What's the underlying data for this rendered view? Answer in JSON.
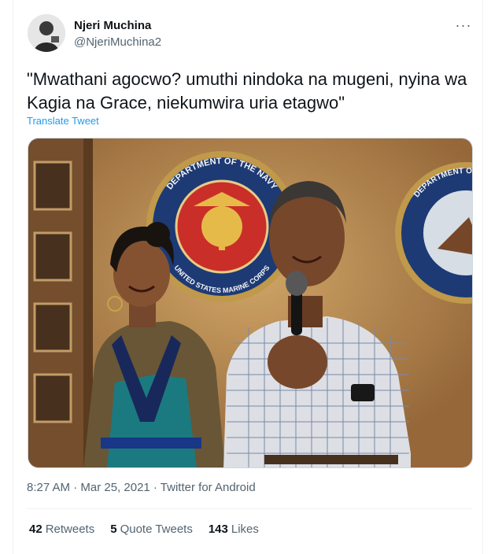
{
  "author": {
    "name": "Njeri Muchina",
    "handle": "@NjeriMuchina2"
  },
  "more_icon": "more-horizontal-icon",
  "tweet": {
    "text": "\"Mwathani agocwo? umuthi nindoka na mugeni, nyina wa Kagia na Grace, niekumwira uria etagwo\"",
    "translate_label": "Translate Tweet"
  },
  "media": {
    "seal_left_top_text": "DEPARTMENT OF THE NAVY",
    "seal_left_bottom_text": "UNITED STATES MARINE CORPS",
    "seal_right_text": "DEPARTMENT OF THE NAVY UNITED STATES"
  },
  "meta": {
    "text": "8:27 AM · Mar 25, 2021 · Twitter for Android"
  },
  "stats": {
    "retweets_count": "42",
    "retweets_label": "Retweets",
    "quotes_count": "5",
    "quotes_label": "Quote Tweets",
    "likes_count": "143",
    "likes_label": "Likes"
  },
  "colors": {
    "link": "#1d9bf0",
    "secondary_text": "#536471",
    "primary_text": "#0f1419"
  }
}
